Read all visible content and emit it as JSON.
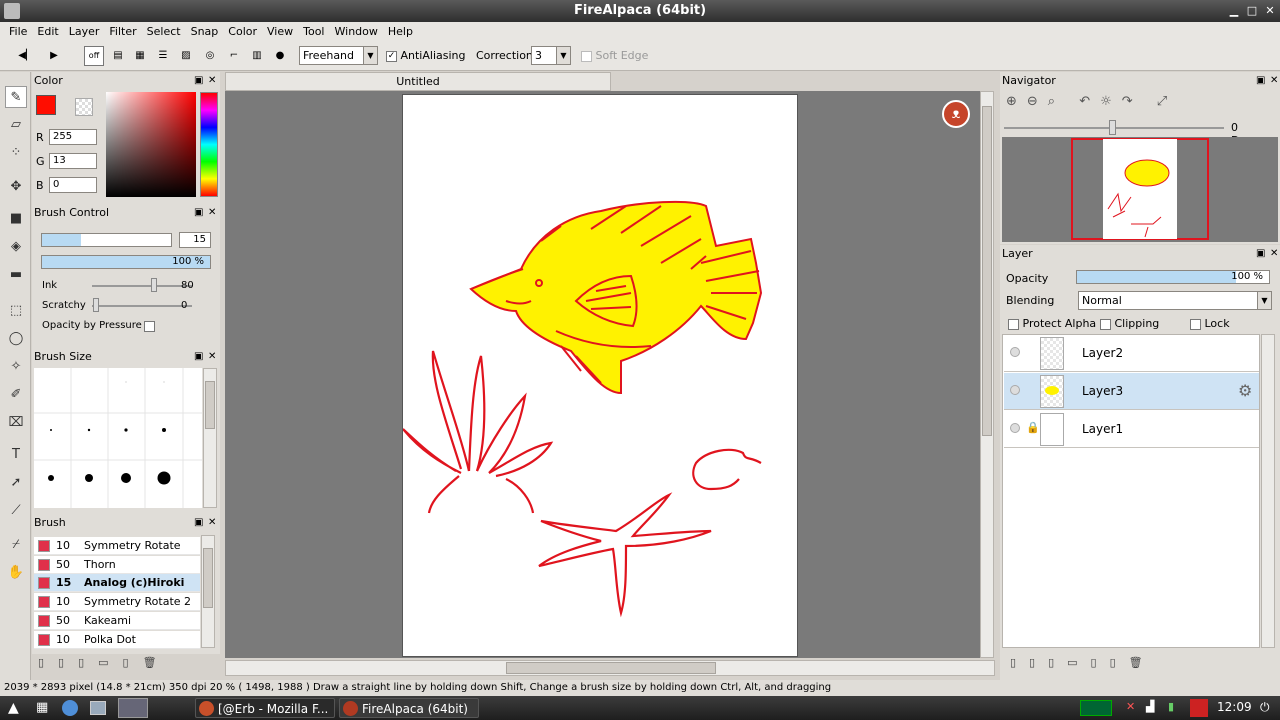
{
  "window": {
    "title": "FireAlpaca (64bit)"
  },
  "menu": [
    "File",
    "Edit",
    "Layer",
    "Filter",
    "Select",
    "Snap",
    "Color",
    "View",
    "Tool",
    "Window",
    "Help"
  ],
  "toolbar": {
    "brush_mode": "Freehand",
    "antialiasing_label": "AntiAliasing",
    "antialiasing_checked": true,
    "correction_label": "Correction",
    "correction_value": "3",
    "soft_edge_label": "Soft Edge"
  },
  "color_panel": {
    "title": "Color",
    "r_label": "R",
    "r_value": "255",
    "g_label": "G",
    "g_value": "13",
    "b_label": "B",
    "b_value": "0",
    "current_color": "#ff0d00"
  },
  "brush_control": {
    "title": "Brush Control",
    "size_value": "15",
    "opacity_value": "100 %",
    "opacity_fraction": 1.0,
    "ink_label": "Ink",
    "ink_value": "80",
    "scratchy_label": "Scratchy",
    "scratchy_value": "0",
    "opacity_by_pressure_label": "Opacity by Pressure"
  },
  "brush_size_panel": {
    "title": "Brush Size"
  },
  "brush_panel": {
    "title": "Brush",
    "items": [
      {
        "size": "10",
        "name": "Symmetry Rotate"
      },
      {
        "size": "50",
        "name": "Thorn"
      },
      {
        "size": "15",
        "name": "Analog (c)Hiroki"
      },
      {
        "size": "10",
        "name": "Symmetry Rotate 2"
      },
      {
        "size": "50",
        "name": "Kakeami"
      },
      {
        "size": "10",
        "name": "Polka Dot"
      }
    ],
    "active_index": 2
  },
  "document": {
    "tab_title": "Untitled"
  },
  "navigator": {
    "title": "Navigator",
    "rotation_label": "0 Degree"
  },
  "layer_panel": {
    "title": "Layer",
    "opacity_label": "Opacity",
    "opacity_value": "100 %",
    "blending_label": "Blending",
    "blending_value": "Normal",
    "protect_alpha_label": "Protect Alpha",
    "clipping_label": "Clipping",
    "lock_label": "Lock",
    "layers": [
      {
        "name": "Layer2"
      },
      {
        "name": "Layer3"
      },
      {
        "name": "Layer1"
      }
    ],
    "active_layer": "Layer3"
  },
  "status": {
    "text": "2039 * 2893 pixel  (14.8 * 21cm)  350 dpi  20 %  ( 1498, 1988 )  Draw a straight line by holding down Shift, Change a brush size by holding down Ctrl, Alt, and dragging"
  },
  "taskbar": {
    "tasks": [
      "[@Erb - Mozilla F...",
      "FireAlpaca (64bit)"
    ],
    "clock": "12:09"
  }
}
